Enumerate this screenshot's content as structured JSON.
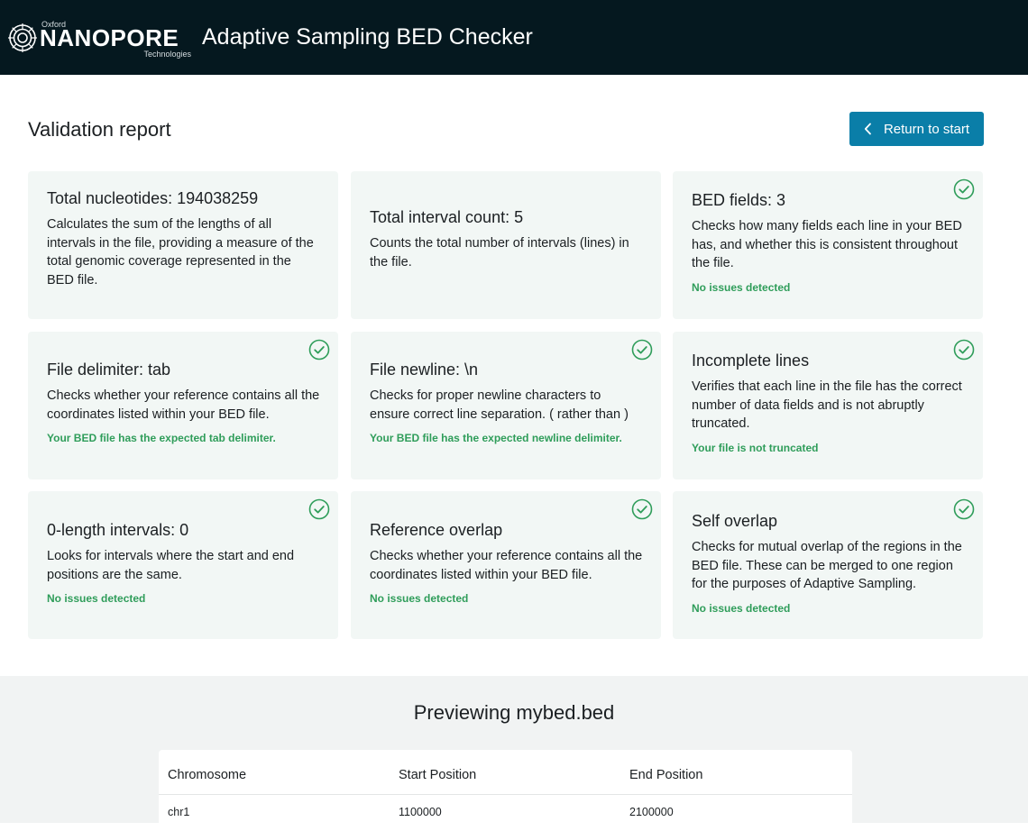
{
  "header": {
    "logo_oxford": "Oxford",
    "logo_main": "NANOPORE",
    "logo_tech": "Technologies",
    "app_title": "Adaptive Sampling BED Checker"
  },
  "report": {
    "title": "Validation report",
    "return_label": "Return to start"
  },
  "cards": [
    {
      "title": "Total nucleotides: 194038259",
      "description": "Calculates the sum of the lengths of all intervals in the file, providing a measure of the total genomic coverage represented in the BED file.",
      "status": "",
      "check": false
    },
    {
      "title": "Total interval count: 5",
      "description": "Counts the total number of intervals (lines) in the file.",
      "status": "",
      "check": false
    },
    {
      "title": "BED fields: 3",
      "description": "Checks how many fields each line in your BED has, and whether this is consistent throughout the file.",
      "status": "No issues detected",
      "check": true
    },
    {
      "title": "File delimiter: tab",
      "description": "Checks whether your reference contains all the coordinates listed within your BED file.",
      "status": "Your BED file has the expected tab delimiter.",
      "check": true
    },
    {
      "title": "File newline: \\n",
      "description": "Checks for proper newline characters to ensure correct line separation. ( rather than )",
      "status": "Your BED file has the expected newline delimiter.",
      "check": true
    },
    {
      "title": "Incomplete lines",
      "description": "Verifies that each line in the file has the correct number of data fields and is not abruptly truncated.",
      "status": "Your file is not truncated",
      "check": true
    },
    {
      "title": "0-length intervals: 0",
      "description": "Looks for intervals where the start and end positions are the same.",
      "status": "No issues detected",
      "check": true
    },
    {
      "title": "Reference overlap",
      "description": "Checks whether your reference contains all the coordinates listed within your BED file.",
      "status": "No issues detected",
      "check": true
    },
    {
      "title": "Self overlap",
      "description": "Checks for mutual overlap of the regions in the BED file. These can be merged to one region for the purposes of Adaptive Sampling.",
      "status": "No issues detected",
      "check": true
    }
  ],
  "preview": {
    "title": "Previewing mybed.bed",
    "columns": [
      "Chromosome",
      "Start Position",
      "End Position"
    ],
    "rows": [
      [
        "chr1",
        "1100000",
        "2100000"
      ]
    ]
  },
  "colors": {
    "header_bg": "#05181f",
    "accent": "#0a7ea8",
    "success": "#2f9d5a",
    "card_bg": "#f2f7f5"
  }
}
